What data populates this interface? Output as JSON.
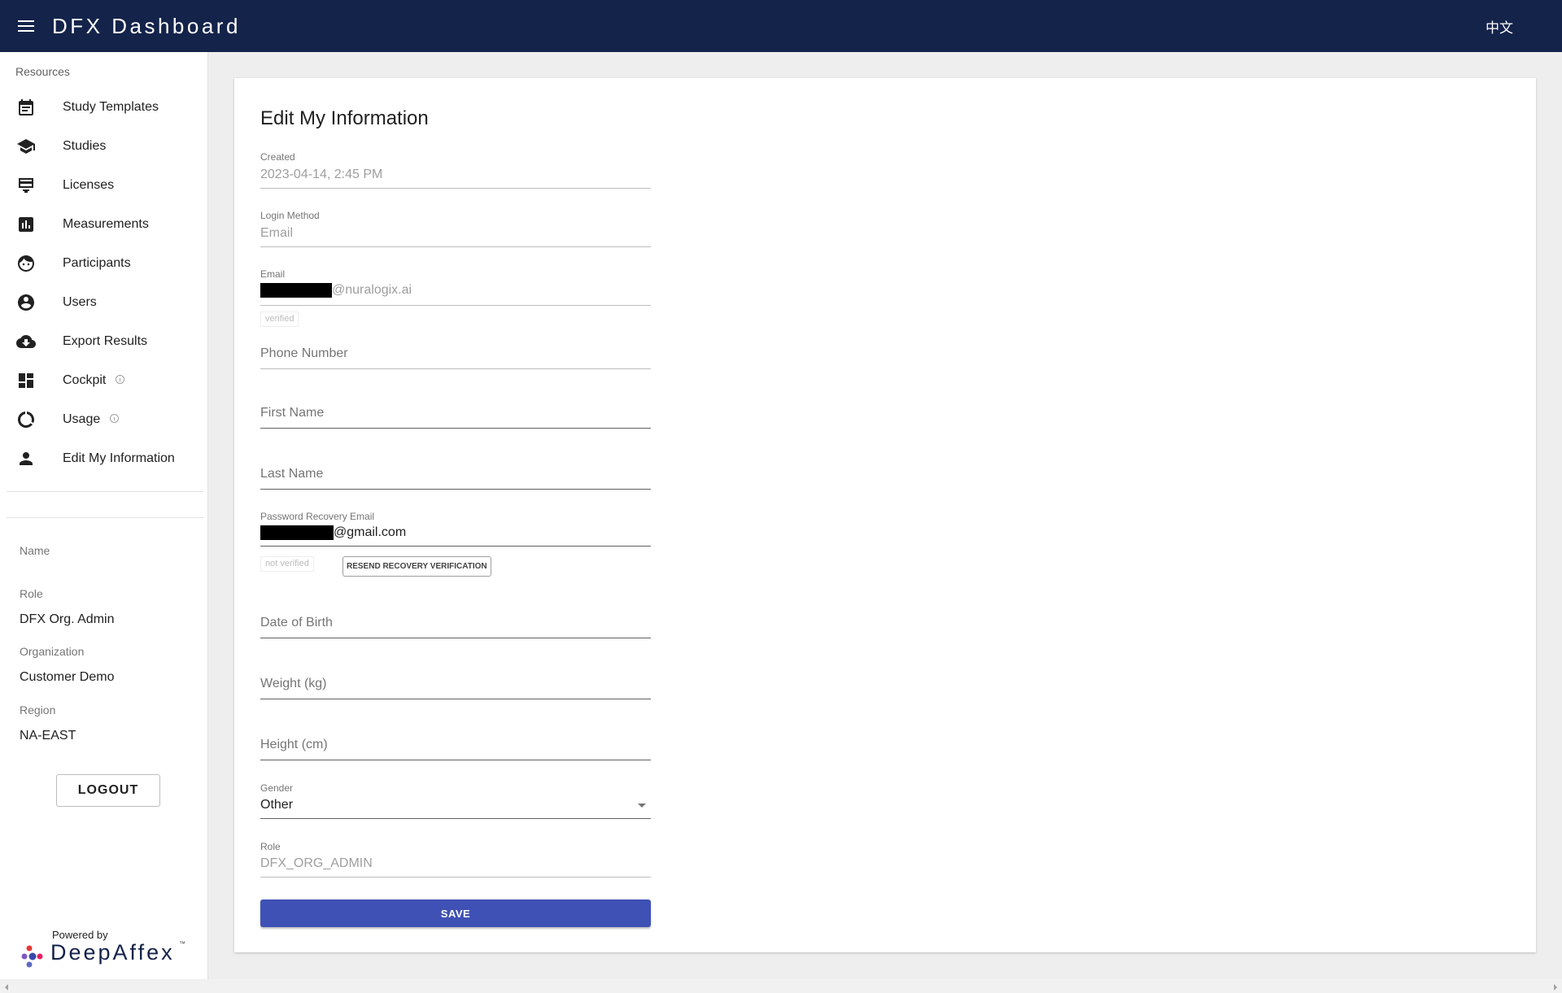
{
  "header": {
    "title": "DFX Dashboard",
    "language": "中文",
    "menu_icon": "hamburger-menu-icon"
  },
  "sidebar": {
    "section_label": "Resources",
    "items": [
      {
        "label": "Study Templates",
        "icon": "calendar-icon"
      },
      {
        "label": "Studies",
        "icon": "graduation-cap-icon"
      },
      {
        "label": "Licenses",
        "icon": "card-icon"
      },
      {
        "label": "Measurements",
        "icon": "bar-chart-icon"
      },
      {
        "label": "Participants",
        "icon": "face-icon"
      },
      {
        "label": "Users",
        "icon": "account-circle-icon"
      },
      {
        "label": "Export Results",
        "icon": "cloud-download-icon"
      },
      {
        "label": "Cockpit",
        "icon": "dashboard-icon"
      },
      {
        "label": "Usage",
        "icon": "donut-icon"
      },
      {
        "label": "Edit My Information",
        "icon": "person-icon"
      }
    ],
    "meta": {
      "name_label": "Name",
      "role_label": "Role",
      "role_value": "DFX Org. Admin",
      "org_label": "Organization",
      "org_value": "Customer Demo",
      "region_label": "Region",
      "region_value": "NA-EAST"
    },
    "logout_label": "LOGOUT",
    "powered_by": "Powered by",
    "brand": "DeepAffex",
    "brand_tm": "™"
  },
  "form": {
    "title": "Edit My Information",
    "created_label": "Created",
    "created_value": "2023-04-14, 2:45 PM",
    "login_method_label": "Login Method",
    "login_method_value": "Email",
    "email_label": "Email",
    "email_domain": "@nuralogix.ai",
    "email_status": "verified",
    "phone_placeholder": "Phone Number",
    "first_name_placeholder": "First Name",
    "last_name_placeholder": "Last Name",
    "recovery_label": "Password Recovery Email",
    "recovery_domain": "@gmail.com",
    "recovery_status": "not verified",
    "resend_label": "RESEND RECOVERY VERIFICATION",
    "dob_placeholder": "Date of Birth",
    "weight_placeholder": "Weight (kg)",
    "height_placeholder": "Height (cm)",
    "gender_label": "Gender",
    "gender_value": "Other",
    "role_label": "Role",
    "role_value": "DFX_ORG_ADMIN",
    "save_label": "SAVE"
  }
}
